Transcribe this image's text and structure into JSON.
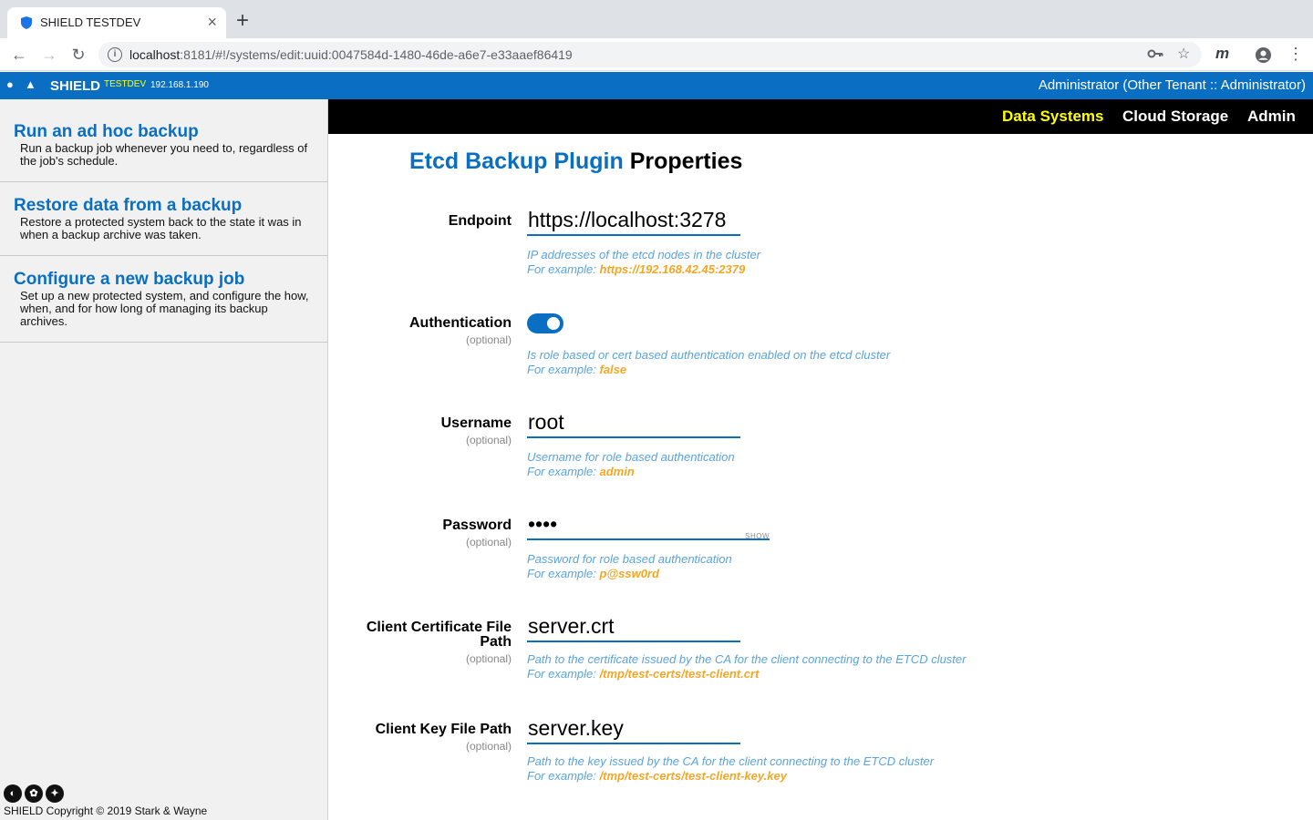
{
  "browser": {
    "tab_title": "SHIELD TESTDEV",
    "tab_close": "×",
    "new_tab": "+",
    "url_host": "localhost",
    "url_rest": ":8181/#!/systems/edit:uuid:0047584d-1480-46de-a6e7-e33aaef86419",
    "profile_initial": "m"
  },
  "topbar": {
    "brand": "SHIELD",
    "env": "TESTDEV",
    "ip": "192.168.1.190",
    "user": "Administrator (Other Tenant :: Administrator)"
  },
  "sidebar": {
    "items": [
      {
        "title": "Run an ad hoc backup",
        "desc": "Run a backup job whenever you need to, regardless of the job's schedule."
      },
      {
        "title": "Restore data from a backup",
        "desc": "Restore a protected system back to the state it was in when a backup archive was taken."
      },
      {
        "title": "Configure a new backup job",
        "desc": "Set up a new protected system, and configure the how, when, and for how long of managing its backup archives."
      }
    ],
    "copyright": "SHIELD Copyright © 2019 Stark & Wayne"
  },
  "nav": {
    "items": [
      "Data Systems",
      "Cloud Storage",
      "Admin"
    ]
  },
  "page": {
    "plugin_name": "Etcd Backup Plugin",
    "heading_suffix": "Properties"
  },
  "fields": {
    "endpoint": {
      "label": "Endpoint",
      "value": "https://localhost:3278",
      "help": "IP addresses of the etcd nodes in the cluster",
      "example_prefix": "For example:",
      "example": "https://192.168.42.45:2379"
    },
    "authentication": {
      "label": "Authentication",
      "optional": "(optional)",
      "enabled": true,
      "help": "Is role based or cert based authentication enabled on the etcd cluster",
      "example_prefix": "For example:",
      "example": "false"
    },
    "username": {
      "label": "Username",
      "optional": "(optional)",
      "value": "root",
      "help": "Username for role based authentication",
      "example_prefix": "For example:",
      "example": "admin"
    },
    "password": {
      "label": "Password",
      "optional": "(optional)",
      "value": "••••",
      "show": "SHOW",
      "help": "Password for role based authentication",
      "example_prefix": "For example:",
      "example": "p@ssw0rd"
    },
    "client_cert": {
      "label_line1": "Client Certificate File",
      "label_line2": "Path",
      "optional": "(optional)",
      "value": "server.crt",
      "help": "Path to the certificate issued by the CA for the client connecting to the ETCD cluster",
      "example_prefix": "For example:",
      "example": "/tmp/test-certs/test-client.crt"
    },
    "client_key": {
      "label": "Client Key File Path",
      "optional": "(optional)",
      "value": "server.key",
      "help": "Path to the key issued by the CA for the client connecting to the ETCD cluster",
      "example_prefix": "For example:",
      "example": "/tmp/test-certs/test-client-key.key"
    }
  },
  "colors": {
    "brand_blue": "#0a6fc2",
    "nav_active": "#ffff00",
    "help_blue": "#5aa3dd",
    "example_orange": "#f5a623"
  }
}
